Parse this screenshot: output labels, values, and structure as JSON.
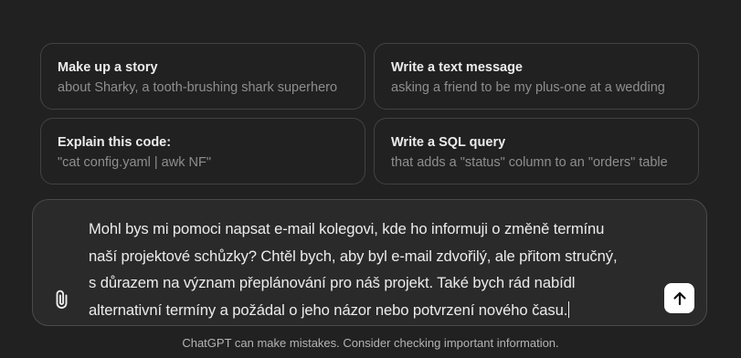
{
  "suggestions": [
    {
      "title": "Make up a story",
      "subtitle": "about Sharky, a tooth-brushing shark superhero"
    },
    {
      "title": "Write a text message",
      "subtitle": "asking a friend to be my plus-one at a wedding"
    },
    {
      "title": "Explain this code:",
      "subtitle": "\"cat config.yaml | awk NF\""
    },
    {
      "title": "Write a SQL query",
      "subtitle": "that adds a \"status\" column to an \"orders\" table"
    }
  ],
  "composer": {
    "text": "Mohl bys mi pomoci napsat e-mail kolegovi, kde ho informuji o změně termínu\nnaší projektové schůzky? Chtěl bych, aby byl e-mail zdvořilý, ale přitom stručný,\ns důrazem na význam přeplánování pro náš projekt. Také bych rád nabídl\nalternativní termíny a požádal o jeho názor nebo potvrzení nového času."
  },
  "footer": {
    "disclaimer": "ChatGPT can make mistakes. Consider checking important information."
  },
  "icons": {
    "attach": "paperclip-icon",
    "send": "arrow-up-icon"
  },
  "colors": {
    "background": "#212121",
    "card_border": "#424242",
    "composer_bg": "#2a2a2a",
    "send_button": "#ffffff"
  }
}
